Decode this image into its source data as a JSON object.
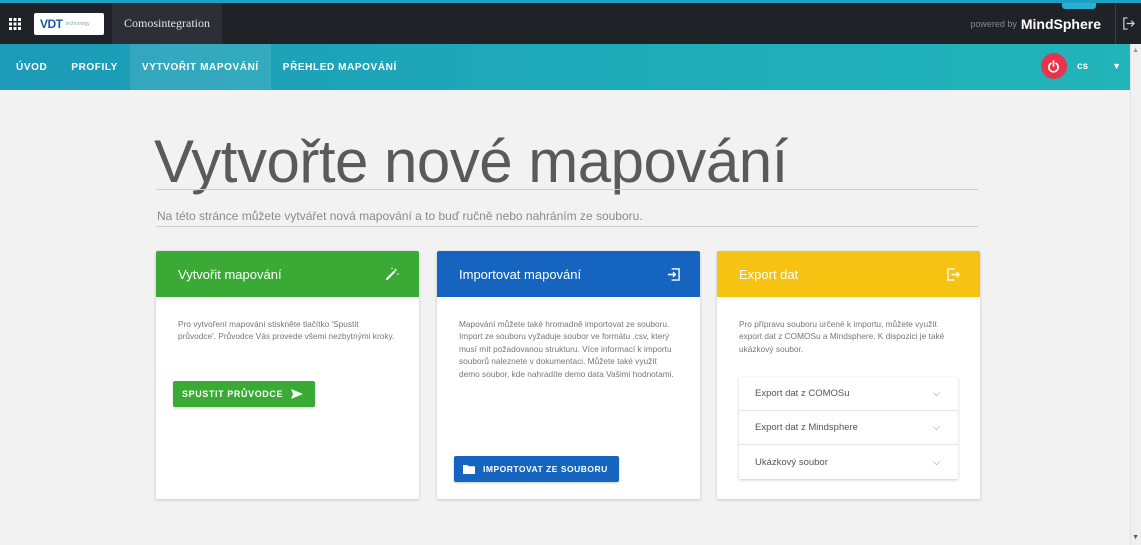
{
  "topbar": {
    "logo_text": "VDT",
    "logo_sub": "technology",
    "app_tab": "Comosintegration",
    "powered_by": "powered by",
    "brand": "MindSphere"
  },
  "nav": {
    "items": [
      {
        "label": "ÚVOD"
      },
      {
        "label": "PROFILY"
      },
      {
        "label": "VYTVOŘIT MAPOVÁNÍ"
      },
      {
        "label": "PŘEHLED MAPOVÁNÍ"
      }
    ],
    "active_index": 2,
    "language": "cs"
  },
  "main": {
    "title": "Vytvořte nové mapování",
    "subtitle": "Na této stránce můžete vytvářet nová mapování a to buď ručně nebo nahráním ze souboru."
  },
  "cards": {
    "create": {
      "title": "Vytvořit mapování",
      "text": "Pro vytvoření mapování stiskněte tlačítko 'Spustit průvodce'. Průvodce Vás provede všemi nezbytnými kroky.",
      "button": "SPUSTIT PRŮVODCE",
      "color": "#3aaa35"
    },
    "import": {
      "title": "Importovat mapování",
      "text": "Mapování můžete také hromadně importovat ze souboru. Import ze souboru vyžaduje soubor ve formátu .csv, který musí mít požadovanou strukturu. Více informací k importu souborů naleznete v dokumentaci. Můžete také využít demo soubor, kde nahradíte demo data Vašimi hodnotami.",
      "button": "IMPORTOVAT ZE SOUBORU",
      "color": "#1565c0"
    },
    "export": {
      "title": "Export dat",
      "text": "Pro přípravu souboru určené k importu, můžete využít export dat z COMOSu a Mindsphere. K dispozici je také ukázkový soubor.",
      "color": "#f7c312",
      "accordion": [
        {
          "label": "Export dat z COMOSu"
        },
        {
          "label": "Export dat z Mindsphere"
        },
        {
          "label": "Ukázkový soubor"
        }
      ]
    }
  },
  "icons": {
    "apps": "grid-icon",
    "logout": "logout-icon",
    "power": "power-icon",
    "wand": "magic-wand-icon",
    "import": "import-icon",
    "export": "export-icon",
    "folder": "folder-icon",
    "send": "send-arrow-icon",
    "chevron": "chevron-down-icon"
  }
}
